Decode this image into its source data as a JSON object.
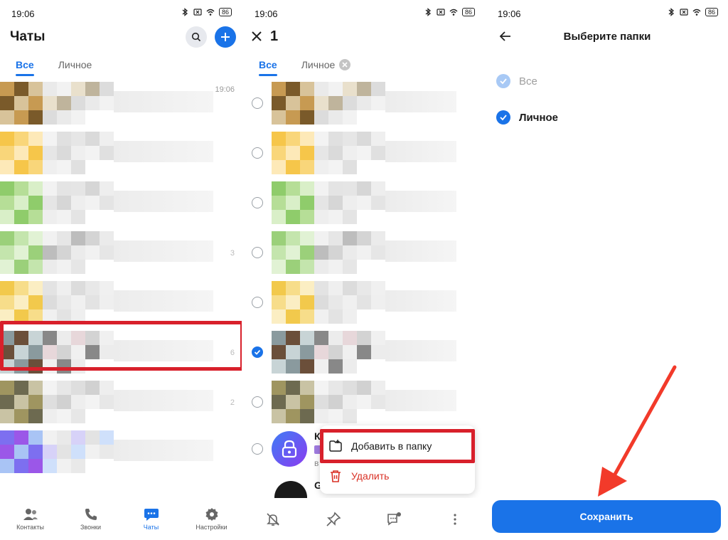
{
  "status_bar": {
    "time": "19:06",
    "battery": "86"
  },
  "panel1": {
    "title": "Чаты",
    "tabs": [
      {
        "label": "Все",
        "active": true
      },
      {
        "label": "Личное",
        "active": false
      }
    ],
    "chat_rows": [
      {
        "time": "19:06",
        "count": "",
        "palette": [
          "#c79a52",
          "#7a5a2a",
          "#d8c39a",
          "#e9e0cc",
          "#bfb49c",
          "#dcdcdc",
          "#eaeaea",
          "#f2f2f2"
        ]
      },
      {
        "time": "",
        "count": "",
        "palette": [
          "#f6c64a",
          "#f9d67a",
          "#fde9b8",
          "#e6e6e6",
          "#dadada",
          "#efefef",
          "#f3f3f3",
          "#e0e0e0"
        ]
      },
      {
        "time": "",
        "count": "",
        "palette": [
          "#8fcc6b",
          "#b6de97",
          "#d9efc8",
          "#e5e5e5",
          "#d6d6d6",
          "#eeeeee",
          "#f2f2f2",
          "#e4e4e4"
        ]
      },
      {
        "time": "",
        "count": "3",
        "palette": [
          "#9bd07a",
          "#c4e5ad",
          "#e1f2d4",
          "#bdbdbd",
          "#d4d4d4",
          "#ebebeb",
          "#f1f1f1",
          "#e6e6e6"
        ]
      },
      {
        "time": "",
        "count": "",
        "palette": [
          "#f2c94c",
          "#f7dd8a",
          "#fbeec3",
          "#dcdcdc",
          "#e8e8e8",
          "#f0f0f0",
          "#e3e3e3",
          "#efefef"
        ]
      },
      {
        "time": "",
        "count": "6",
        "palette": [
          "#8a9a9e",
          "#6b4f3a",
          "#c8d4d6",
          "#e7d7da",
          "#d3d3d3",
          "#f0f0f0",
          "#888888",
          "#ececec"
        ]
      },
      {
        "time": "",
        "count": "2",
        "palette": [
          "#9f9560",
          "#6d6a50",
          "#c9c3a4",
          "#dedede",
          "#d1d1d1",
          "#eeeeee",
          "#f3f3f3",
          "#e7e7e7"
        ]
      },
      {
        "time": "",
        "count": "",
        "palette": [
          "#7d6ff0",
          "#9b57e8",
          "#a9c4f5",
          "#d7d2f8",
          "#e3e3e3",
          "#cfe0fb",
          "#f1f1f1",
          "#e9e9e9"
        ]
      }
    ],
    "nav": [
      {
        "label": "Контакты",
        "active": false,
        "icon": "contacts-icon"
      },
      {
        "label": "Звонки",
        "active": false,
        "icon": "phone-icon"
      },
      {
        "label": "Чаты",
        "active": true,
        "icon": "chat-icon"
      },
      {
        "label": "Настройки",
        "active": false,
        "icon": "gear-icon"
      }
    ]
  },
  "panel2": {
    "selected_count": "1",
    "tabs": [
      {
        "label": "Все",
        "active": true
      },
      {
        "label": "Личное",
        "active": false
      }
    ],
    "partial_names": [
      "К",
      "G"
    ],
    "partial_sub": "в",
    "menu": {
      "add_to_folder": "Добавить в папку",
      "delete": "Удалить"
    },
    "actions": [
      "mute-icon",
      "pin-icon",
      "mark-read-icon",
      "more-icon"
    ]
  },
  "panel3": {
    "title": "Выберите папки",
    "folders": [
      {
        "label": "Все",
        "checked": true,
        "disabled": true
      },
      {
        "label": "Личное",
        "checked": true,
        "disabled": false
      }
    ],
    "save_label": "Сохранить"
  },
  "colors": {
    "accent": "#1a73e8",
    "highlight": "#d8202b",
    "danger": "#d93025",
    "arrow": "#f23a2a"
  }
}
